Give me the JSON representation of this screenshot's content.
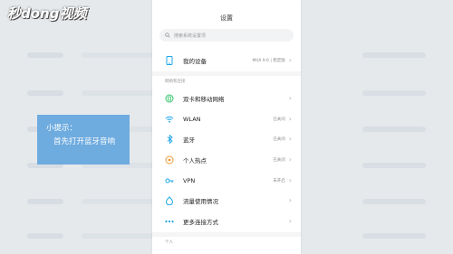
{
  "watermark": {
    "text": "秒dong视频"
  },
  "tip": {
    "line1": "小提示：",
    "line2": "首先打开蓝牙音响"
  },
  "phone": {
    "title": "设置",
    "search_placeholder": "搜索系统设置项",
    "device": {
      "label": "我的设备",
      "value": "MIUI 9.6 | 稳定版",
      "icon": "phone-icon"
    },
    "section_network": "网络和连接",
    "network_items": [
      {
        "label": "双卡和移动网络",
        "value": "",
        "icon": "sim-icon"
      },
      {
        "label": "WLAN",
        "value": "已关闭",
        "icon": "wifi-icon"
      },
      {
        "label": "蓝牙",
        "value": "已关闭",
        "icon": "bluetooth-icon"
      },
      {
        "label": "个人热点",
        "value": "已关闭",
        "icon": "hotspot-icon"
      },
      {
        "label": "VPN",
        "value": "未开启",
        "icon": "vpn-icon"
      },
      {
        "label": "流量使用情况",
        "value": "",
        "icon": "data-usage-icon"
      },
      {
        "label": "更多连接方式",
        "value": "",
        "icon": "more-connections-icon"
      }
    ],
    "section_personal": "个人"
  },
  "colors": {
    "accent": "#1aa5e6",
    "tip_bg": "#6eabdf",
    "green": "#34c46a",
    "orange": "#f39a3a"
  }
}
